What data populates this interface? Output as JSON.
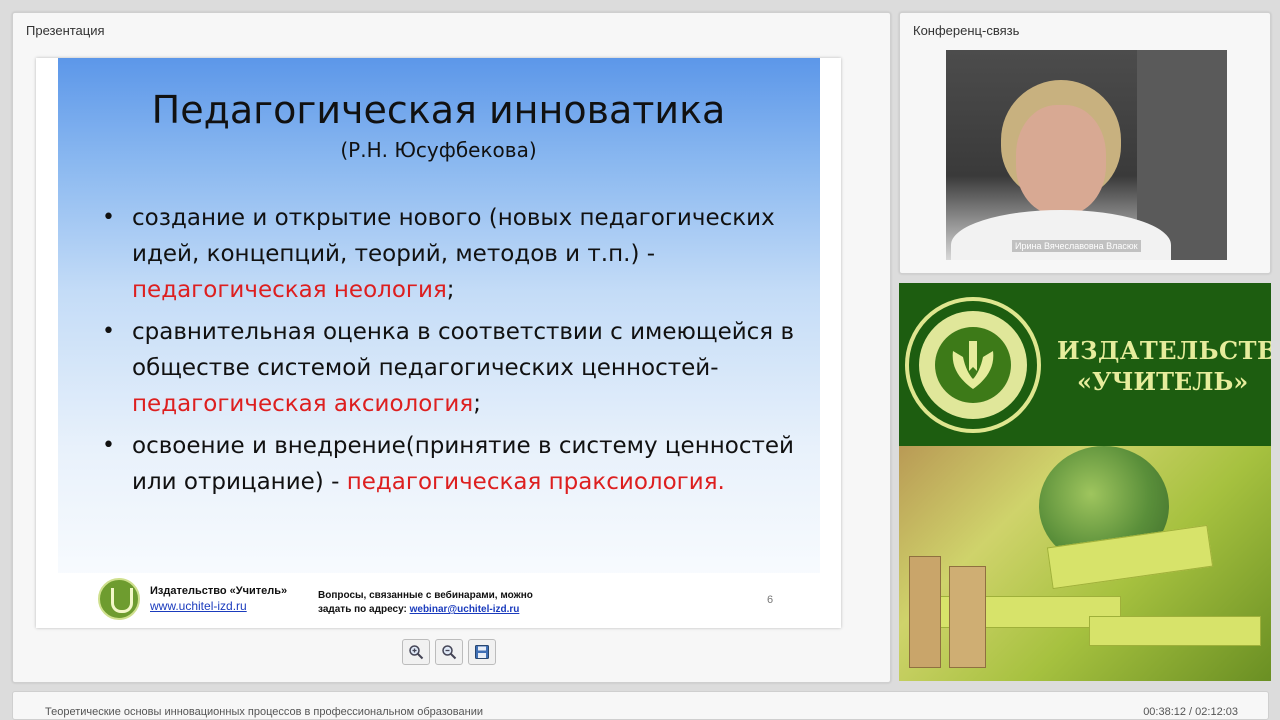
{
  "presentation": {
    "panel_title": "Презентация",
    "slide": {
      "title": "Педагогическая инноватика",
      "subtitle": "(Р.Н. Юсуфбекова)",
      "bullets": [
        {
          "text": "создание и открытие нового (новых педагогических идей, концепций, теорий, методов и т.п.) - ",
          "highlight": "педагогическая неология",
          "tail": ";"
        },
        {
          "text": "сравнительная оценка в соответствии с имеющейся в обществе системой педагогических ценностей-",
          "highlight": "педагогическая аксиология",
          "tail": ";"
        },
        {
          "text": "освоение и внедрение(принятие в систему ценностей или отрицание) - ",
          "highlight": "педагогическая праксиология.",
          "tail": ""
        }
      ],
      "footer": {
        "publisher_name": "Издательство «Учитель»",
        "publisher_url": "www.uchitel-izd.ru",
        "questions_line1": "Вопросы, связанные с вебинарами, можно",
        "questions_line2_prefix": "задать по адресу: ",
        "questions_email": "webinar@uchitel-izd.ru",
        "page_number": "6"
      }
    },
    "toolbar": {
      "zoom_in_icon": "zoom-in-icon",
      "zoom_out_icon": "zoom-out-icon",
      "save_icon": "save-icon"
    }
  },
  "conference": {
    "panel_title": "Конференц-связь",
    "speaker_name": "Ирина Вячеславовна Власюк"
  },
  "brand": {
    "line1": "ИЗДАТЕЛЬСТВО",
    "line2": "«УЧИТЕЛЬ»",
    "colors": {
      "green": "#1d5d10",
      "light": "#e6ec9c"
    }
  },
  "bottombar": {
    "course_title": "Теоретические основы инновационных процессов в профессиональном образовании",
    "timer": "00:38:12 / 02:12:03"
  },
  "colors": {
    "highlight_red": "#dd1f1f",
    "link_blue": "#1a3bbd"
  }
}
